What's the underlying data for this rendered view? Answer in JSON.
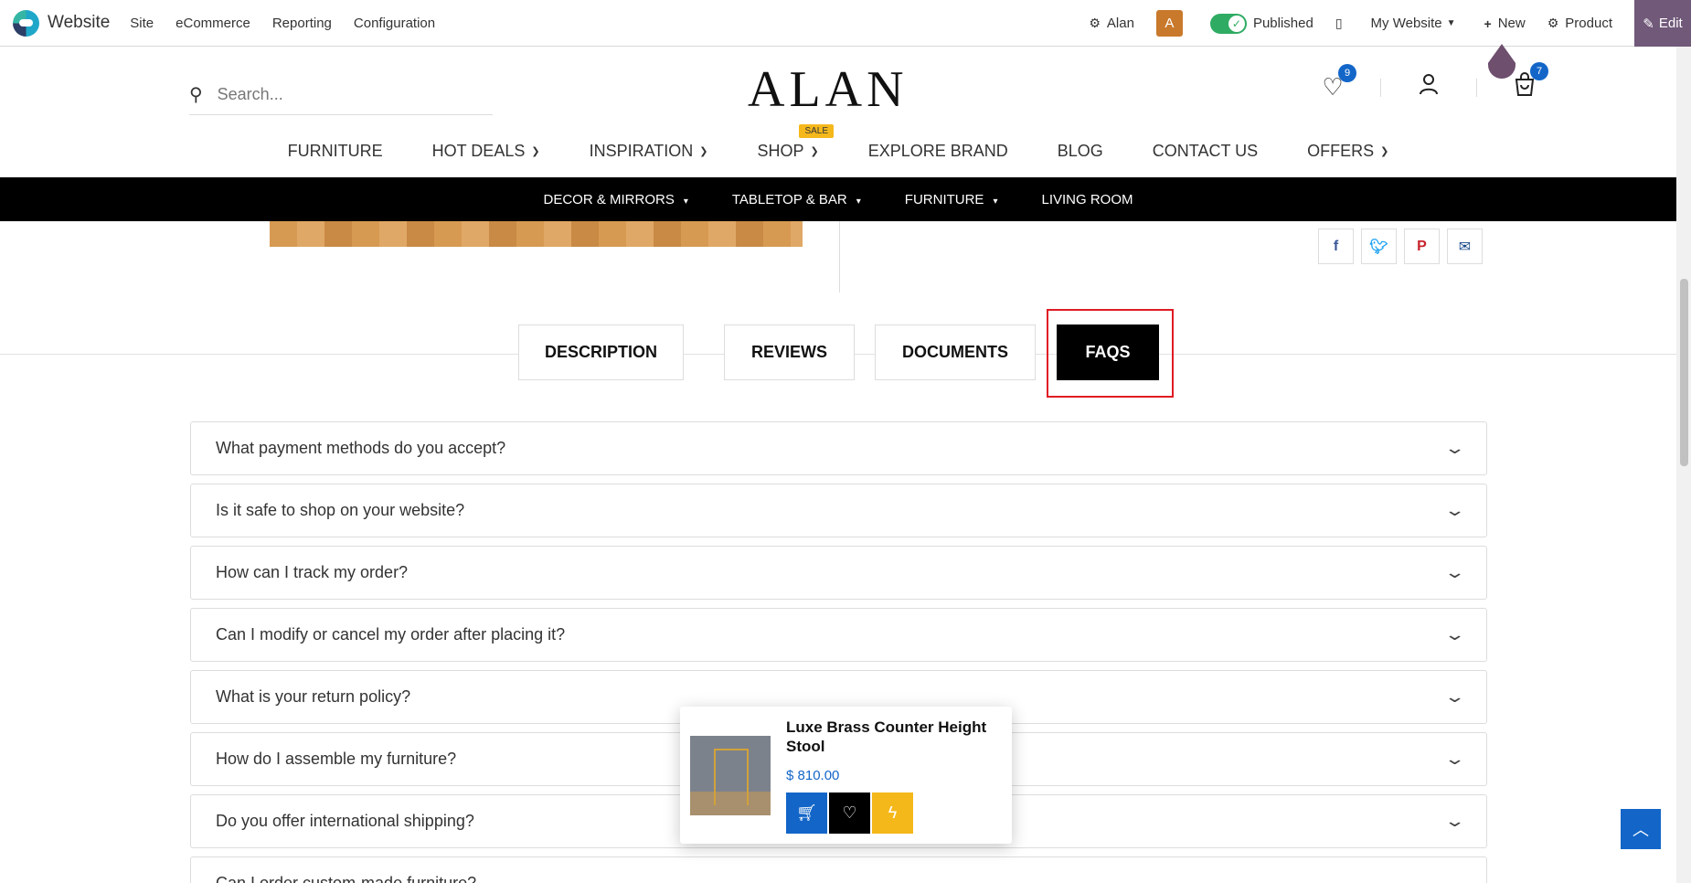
{
  "admin_bar": {
    "brand": "Website",
    "menu": [
      "Site",
      "eCommerce",
      "Reporting",
      "Configuration"
    ],
    "user": "Alan",
    "avatar_letter": "A",
    "published_label": "Published",
    "website_selector": "My Website",
    "new_label": "New",
    "product_label": "Product",
    "edit_label": "Edit"
  },
  "header": {
    "search_placeholder": "Search...",
    "logo": "ALAN",
    "wishlist_count": "9",
    "cart_count": "7"
  },
  "main_nav": [
    {
      "label": "FURNITURE",
      "dropdown": false
    },
    {
      "label": "HOT DEALS",
      "dropdown": true
    },
    {
      "label": "INSPIRATION",
      "dropdown": true
    },
    {
      "label": "SHOP",
      "dropdown": true,
      "badge": "SALE"
    },
    {
      "label": "EXPLORE BRAND",
      "dropdown": false
    },
    {
      "label": "BLOG",
      "dropdown": false
    },
    {
      "label": "CONTACT US",
      "dropdown": false
    },
    {
      "label": "OFFERS",
      "dropdown": true
    }
  ],
  "category_bar": [
    {
      "label": "DECOR & MIRRORS",
      "dropdown": true
    },
    {
      "label": "TABLETOP & BAR",
      "dropdown": true
    },
    {
      "label": "FURNITURE",
      "dropdown": true
    },
    {
      "label": "LIVING ROOM",
      "dropdown": false
    }
  ],
  "share_icons": [
    "facebook-icon",
    "twitter-icon",
    "pinterest-icon",
    "email-icon"
  ],
  "tabs": [
    {
      "label": "DESCRIPTION",
      "active": false
    },
    {
      "label": "REVIEWS",
      "active": false
    },
    {
      "label": "DOCUMENTS",
      "active": false
    },
    {
      "label": "FAQS",
      "active": true
    }
  ],
  "faqs": [
    "What payment methods do you accept?",
    "Is it safe to shop on your website?",
    "How can I track my order?",
    "Can I modify or cancel my order after placing it?",
    "What is your return policy?",
    "How do I assemble my furniture?",
    "Do you offer international shipping?",
    "Can I order custom-made furniture?"
  ],
  "product_popup": {
    "name": "Luxe Brass Counter Height Stool",
    "price": "$ 810.00"
  },
  "colors": {
    "accent_blue": "#1366c8",
    "edit_purple": "#71597a",
    "highlight_red": "#e01b24",
    "sale_yellow": "#f5b81b",
    "published_green": "#2fab63"
  }
}
